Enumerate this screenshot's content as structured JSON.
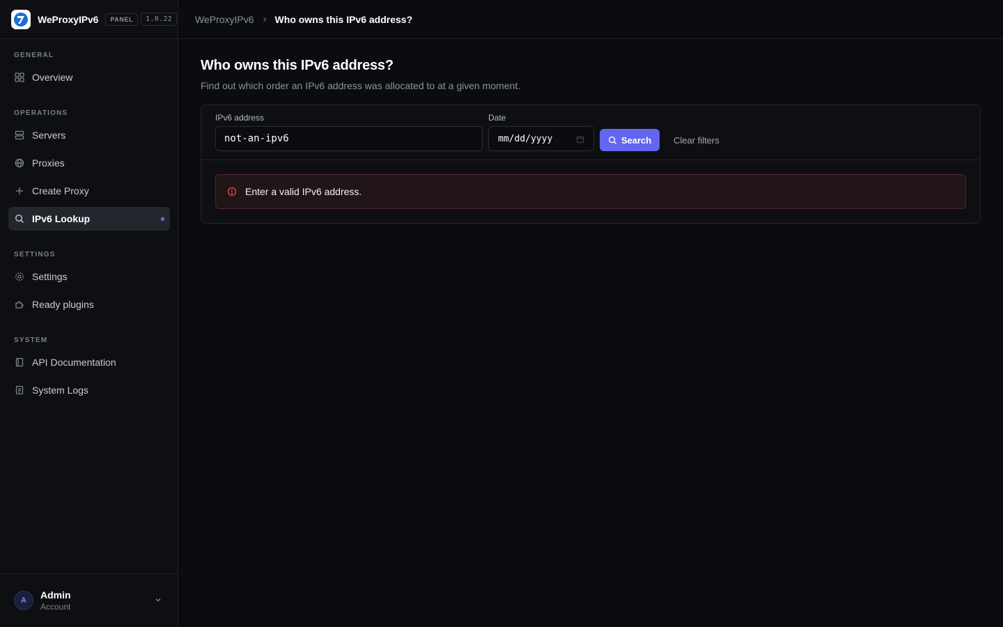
{
  "brand": {
    "name": "WeProxyIPv6",
    "badge": "PANEL",
    "version": "1.0.22"
  },
  "sidebar": {
    "sections": [
      {
        "heading": "GENERAL",
        "items": [
          {
            "label": "Overview",
            "icon": "grid-icon"
          }
        ]
      },
      {
        "heading": "OPERATIONS",
        "items": [
          {
            "label": "Servers",
            "icon": "server-icon"
          },
          {
            "label": "Proxies",
            "icon": "globe-icon"
          },
          {
            "label": "Create Proxy",
            "icon": "plus-icon"
          },
          {
            "label": "IPv6 Lookup",
            "icon": "search-icon",
            "active": true
          }
        ]
      },
      {
        "heading": "SETTINGS",
        "items": [
          {
            "label": "Settings",
            "icon": "gear-icon"
          },
          {
            "label": "Ready plugins",
            "icon": "puzzle-icon"
          }
        ]
      },
      {
        "heading": "SYSTEM",
        "items": [
          {
            "label": "API Documentation",
            "icon": "book-icon"
          },
          {
            "label": "System Logs",
            "icon": "file-icon"
          }
        ]
      }
    ]
  },
  "account": {
    "initial": "A",
    "name": "Admin",
    "role": "Account"
  },
  "breadcrumb": {
    "root": "WeProxyIPv6",
    "current": "Who owns this IPv6 address?"
  },
  "page": {
    "title": "Who owns this IPv6 address?",
    "subtitle": "Find out which order an IPv6 address was allocated to at a given moment."
  },
  "filters": {
    "ipv6_label": "IPv6 address",
    "ipv6_value": "not-an-ipv6",
    "date_label": "Date",
    "date_value": "mm/dd/yyyy",
    "search_label": "Search",
    "clear_label": "Clear filters"
  },
  "error": {
    "message": "Enter a valid IPv6 address."
  },
  "colors": {
    "accent": "#6366f1",
    "error": "#e5484d",
    "background": "#0b0c0f"
  }
}
